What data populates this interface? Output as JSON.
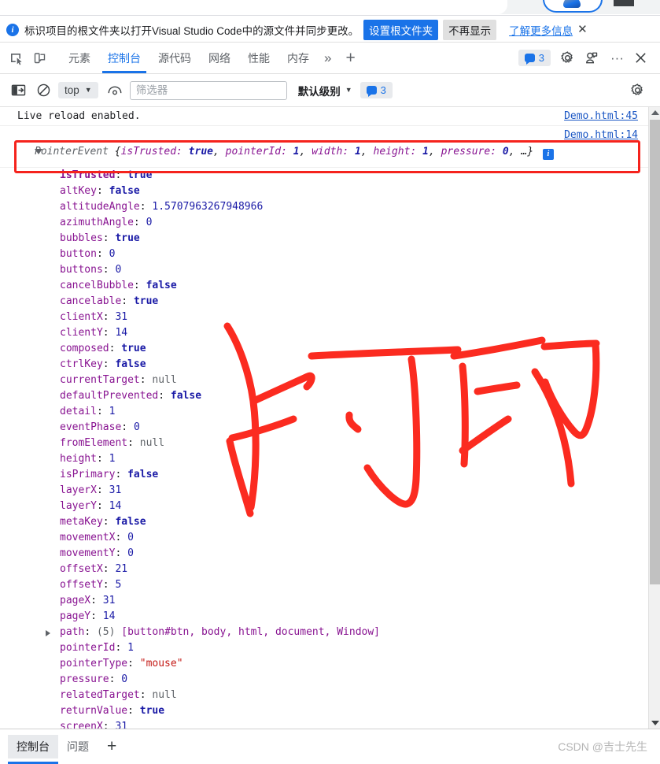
{
  "infobar": {
    "message": "标识项目的根文件夹以打开Visual Studio Code中的源文件并同步更改。",
    "primary_button": "设置根文件夹",
    "secondary_button": "不再显示",
    "learn_more": "了解更多信息",
    "close": "✕",
    "accent_color": "#1a73e8"
  },
  "tabbar": {
    "tabs": [
      {
        "label": "元素",
        "active": false
      },
      {
        "label": "控制台",
        "active": true
      },
      {
        "label": "源代码",
        "active": false
      },
      {
        "label": "网络",
        "active": false
      },
      {
        "label": "性能",
        "active": false
      },
      {
        "label": "内存",
        "active": false
      }
    ],
    "overflow": "»",
    "add": "+",
    "issues_count": "3",
    "more_options": "···",
    "close": "✕"
  },
  "console_toolbar": {
    "context": "top",
    "filter_placeholder": "筛选器",
    "filter_value": "",
    "level": "默认级别",
    "level_caret": "▼",
    "issues_count": "3"
  },
  "console": {
    "first_log": {
      "text": "Live reload enabled.",
      "source": "Demo.html:45"
    },
    "object_log": {
      "source": "Demo.html:14",
      "class_name": "PointerEvent",
      "preview_open": "{",
      "preview_close": ", …}",
      "preview_pairs": [
        {
          "key": "isTrusted",
          "value": "true"
        },
        {
          "key": "pointerId",
          "value": "1"
        },
        {
          "key": "width",
          "value": "1"
        },
        {
          "key": "height",
          "value": "1"
        },
        {
          "key": "pressure",
          "value": "0"
        }
      ],
      "info_badge": "i"
    },
    "properties": [
      {
        "key": "isTrusted",
        "value": "true",
        "type": "bool",
        "own": true
      },
      {
        "key": "altKey",
        "value": "false",
        "type": "bool"
      },
      {
        "key": "altitudeAngle",
        "value": "1.5707963267948966",
        "type": "num"
      },
      {
        "key": "azimuthAngle",
        "value": "0",
        "type": "num"
      },
      {
        "key": "bubbles",
        "value": "true",
        "type": "bool"
      },
      {
        "key": "button",
        "value": "0",
        "type": "num"
      },
      {
        "key": "buttons",
        "value": "0",
        "type": "num"
      },
      {
        "key": "cancelBubble",
        "value": "false",
        "type": "bool"
      },
      {
        "key": "cancelable",
        "value": "true",
        "type": "bool"
      },
      {
        "key": "clientX",
        "value": "31",
        "type": "num"
      },
      {
        "key": "clientY",
        "value": "14",
        "type": "num"
      },
      {
        "key": "composed",
        "value": "true",
        "type": "bool"
      },
      {
        "key": "ctrlKey",
        "value": "false",
        "type": "bool"
      },
      {
        "key": "currentTarget",
        "value": "null",
        "type": "null"
      },
      {
        "key": "defaultPrevented",
        "value": "false",
        "type": "bool"
      },
      {
        "key": "detail",
        "value": "1",
        "type": "num"
      },
      {
        "key": "eventPhase",
        "value": "0",
        "type": "num"
      },
      {
        "key": "fromElement",
        "value": "null",
        "type": "null"
      },
      {
        "key": "height",
        "value": "1",
        "type": "num"
      },
      {
        "key": "isPrimary",
        "value": "false",
        "type": "bool"
      },
      {
        "key": "layerX",
        "value": "31",
        "type": "num"
      },
      {
        "key": "layerY",
        "value": "14",
        "type": "num"
      },
      {
        "key": "metaKey",
        "value": "false",
        "type": "bool"
      },
      {
        "key": "movementX",
        "value": "0",
        "type": "num"
      },
      {
        "key": "movementY",
        "value": "0",
        "type": "num"
      },
      {
        "key": "offsetX",
        "value": "21",
        "type": "num"
      },
      {
        "key": "offsetY",
        "value": "5",
        "type": "num"
      },
      {
        "key": "pageX",
        "value": "31",
        "type": "num"
      },
      {
        "key": "pageY",
        "value": "14",
        "type": "num"
      },
      {
        "key": "path",
        "value": "(5) [button#btn, body, html, document, Window]",
        "type": "array",
        "expandable": true
      },
      {
        "key": "pointerId",
        "value": "1",
        "type": "num"
      },
      {
        "key": "pointerType",
        "value": "\"mouse\"",
        "type": "str"
      },
      {
        "key": "pressure",
        "value": "0",
        "type": "num"
      },
      {
        "key": "relatedTarget",
        "value": "null",
        "type": "null"
      },
      {
        "key": "returnValue",
        "value": "true",
        "type": "bool"
      },
      {
        "key": "screenX",
        "value": "31",
        "type": "num"
      }
    ]
  },
  "annotation": {
    "text": "打印",
    "color": "#fb2b20"
  },
  "highlight": {
    "color": "#f5231d"
  },
  "drawer": {
    "tabs": [
      {
        "label": "控制台",
        "active": true
      },
      {
        "label": "问题",
        "active": false
      }
    ],
    "add": "+",
    "watermark": "CSDN @吉士先生"
  }
}
